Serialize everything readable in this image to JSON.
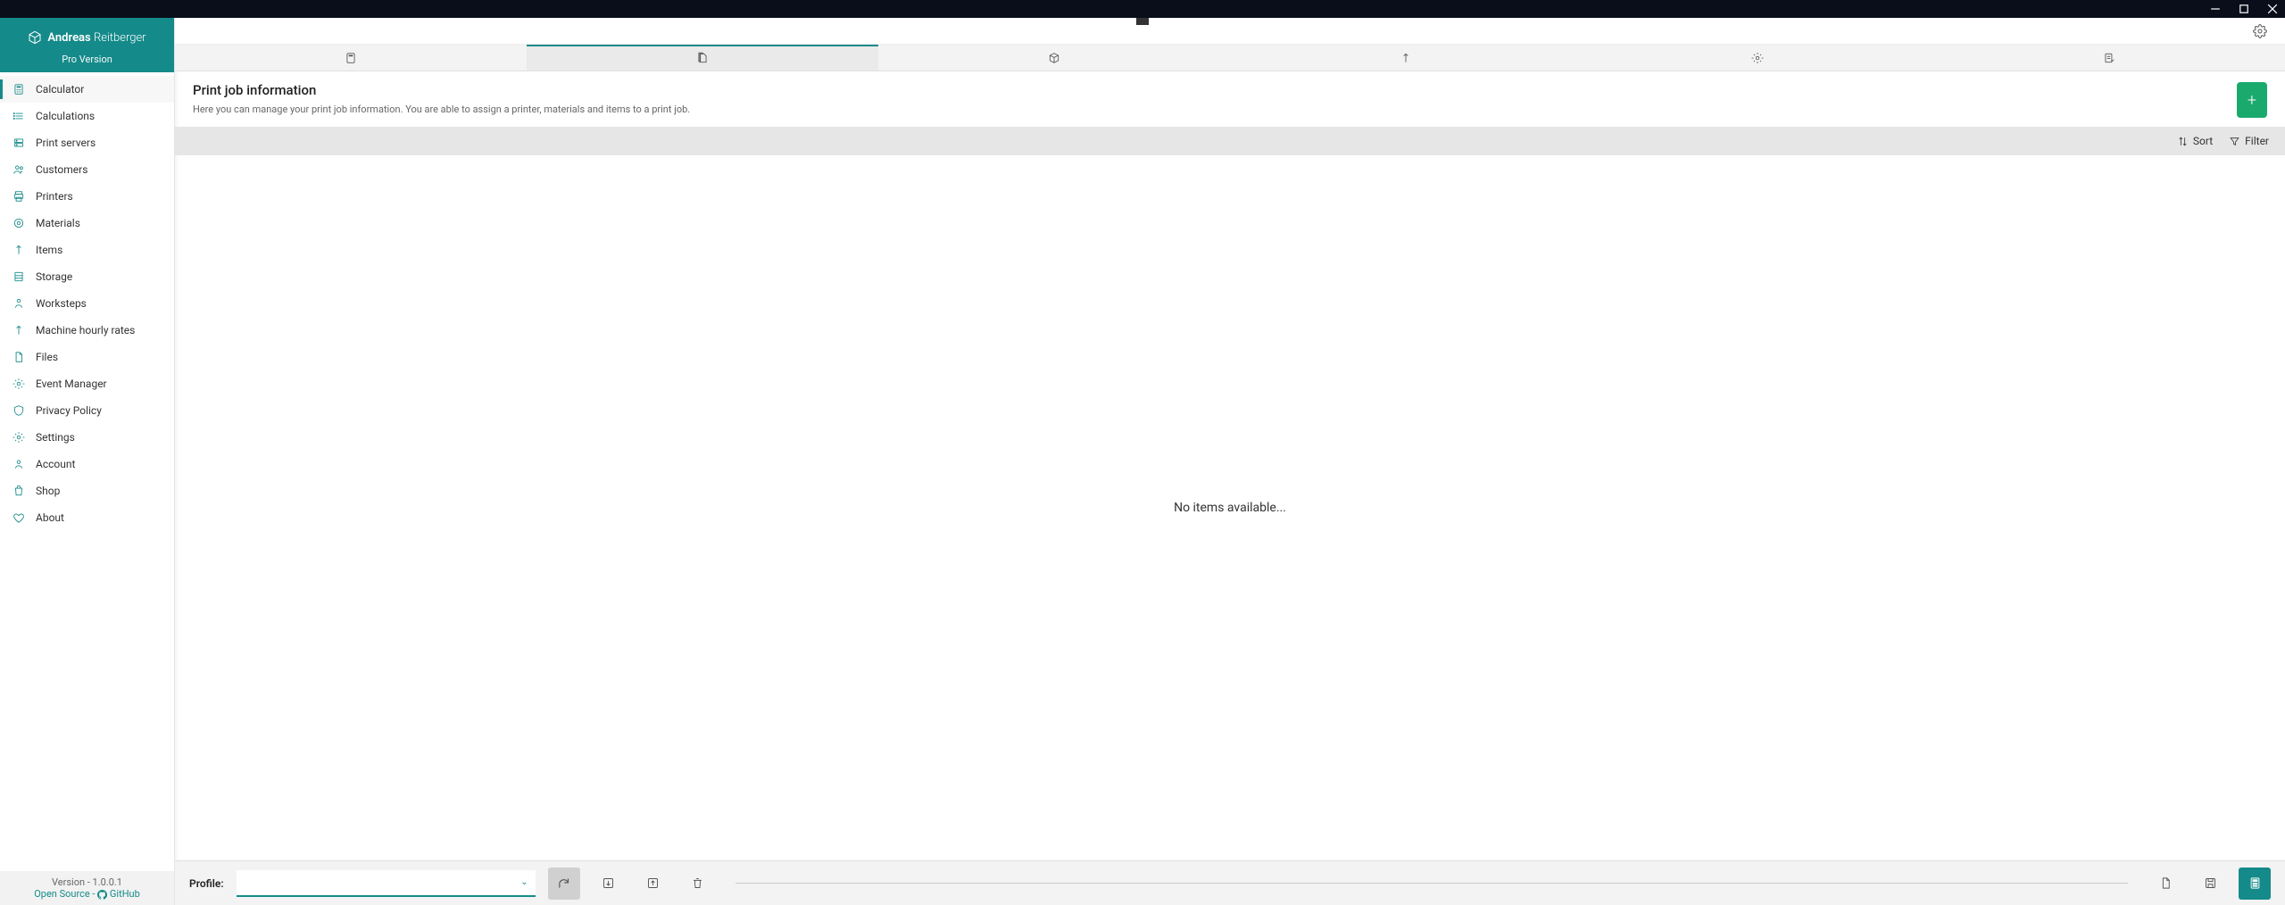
{
  "brand": {
    "first": "Andreas",
    "last": "Reitberger",
    "badge": "Pro Version"
  },
  "sidebar": {
    "items": [
      {
        "label": "Calculator",
        "icon": "calculator"
      },
      {
        "label": "Calculations",
        "icon": "list"
      },
      {
        "label": "Print servers",
        "icon": "server"
      },
      {
        "label": "Customers",
        "icon": "users"
      },
      {
        "label": "Printers",
        "icon": "printer"
      },
      {
        "label": "Materials",
        "icon": "material"
      },
      {
        "label": "Items",
        "icon": "item"
      },
      {
        "label": "Storage",
        "icon": "storage"
      },
      {
        "label": "Worksteps",
        "icon": "worksteps"
      },
      {
        "label": "Machine hourly rates",
        "icon": "rates"
      },
      {
        "label": "Files",
        "icon": "files"
      },
      {
        "label": "Event Manager",
        "icon": "event"
      },
      {
        "label": "Privacy Policy",
        "icon": "privacy"
      },
      {
        "label": "Settings",
        "icon": "settings"
      },
      {
        "label": "Account",
        "icon": "account"
      },
      {
        "label": "Shop",
        "icon": "shop"
      },
      {
        "label": "About",
        "icon": "about"
      }
    ]
  },
  "footer": {
    "version": "Version - 1.0.0.1",
    "os_prefix": "Open Source - ",
    "gh": "GitHub"
  },
  "page": {
    "title": "Print job information",
    "subtitle": "Here you can manage your print job information. You are able to assign a printer, materials and items to a print job."
  },
  "toolbar": {
    "sort": "Sort",
    "filter": "Filter"
  },
  "list": {
    "empty": "No items available..."
  },
  "bottom": {
    "profile_label": "Profile:"
  }
}
